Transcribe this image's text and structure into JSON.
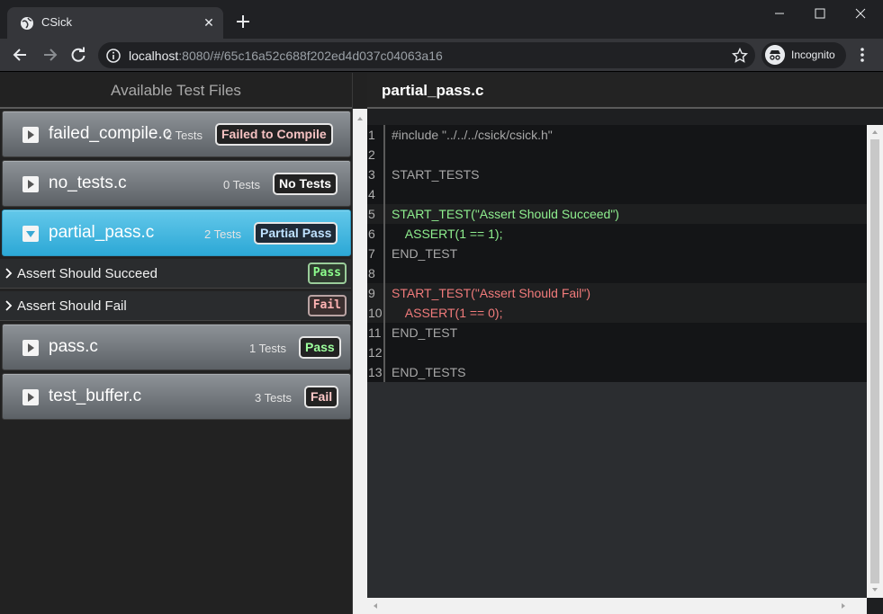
{
  "browser": {
    "tab_title": "CSick",
    "url_host": "localhost",
    "url_rest": ":8080/#/65c16a52c688f202ed4d037c04063a16",
    "incognito_label": "Incognito"
  },
  "sidebar": {
    "header": "Available Test Files",
    "files": [
      {
        "name": "failed_compile.c",
        "count": "2 Tests",
        "badge": "Failed to Compile"
      },
      {
        "name": "no_tests.c",
        "count": "0 Tests",
        "badge": "No Tests"
      },
      {
        "name": "partial_pass.c",
        "count": "2 Tests",
        "badge": "Partial Pass"
      },
      {
        "name": "pass.c",
        "count": "1 Tests",
        "badge": "Pass"
      },
      {
        "name": "test_buffer.c",
        "count": "3 Tests",
        "badge": "Fail"
      }
    ],
    "tests": [
      {
        "name": "Assert Should Succeed",
        "status": "Pass"
      },
      {
        "name": "Assert Should Fail",
        "status": "Fail"
      }
    ]
  },
  "editor": {
    "title": "partial_pass.c",
    "lines": [
      {
        "n": "1",
        "text": "#include \"../../../csick/csick.h\""
      },
      {
        "n": "2",
        "text": ""
      },
      {
        "n": "3",
        "text": "START_TESTS"
      },
      {
        "n": "4",
        "text": ""
      },
      {
        "n": "5",
        "text": "START_TEST(\"Assert Should Succeed\")"
      },
      {
        "n": "6",
        "text": "    ASSERT(1 == 1);"
      },
      {
        "n": "7",
        "text": "END_TEST"
      },
      {
        "n": "8",
        "text": ""
      },
      {
        "n": "9",
        "text": "START_TEST(\"Assert Should Fail\")"
      },
      {
        "n": "10",
        "text": "    ASSERT(1 == 0);"
      },
      {
        "n": "11",
        "text": "END_TEST"
      },
      {
        "n": "12",
        "text": ""
      },
      {
        "n": "13",
        "text": "END_TESTS"
      }
    ]
  },
  "colors": {
    "pass": "#8fef8f",
    "fail": "#f17b7b",
    "active_file": "#3cb6e0"
  }
}
